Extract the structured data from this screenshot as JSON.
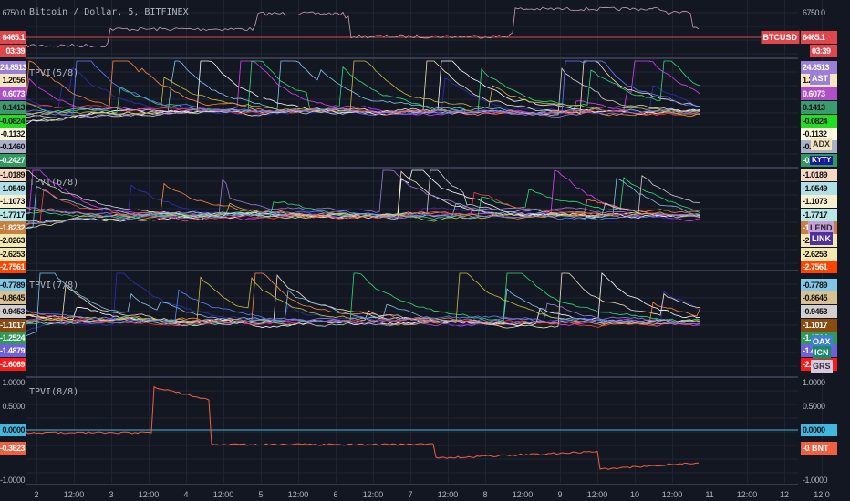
{
  "symbol_title": "Bitcoin / Dollar, 5, BITFINEX",
  "btc": {
    "axis_top": "6750.0",
    "price": "6465.1",
    "countdown": "03:39",
    "tag": "BTCUSD",
    "colors": {
      "price": "#e0474c"
    }
  },
  "panes": [
    {
      "title": "TPVI(5/8)",
      "labels": [
        "24.8513",
        "1.2056",
        "0.6073",
        "0.1413",
        "-0.0824",
        "-0.1132",
        "-0.1460",
        "-0.2427"
      ],
      "tags": [
        "AST",
        "ADX",
        "KYTY"
      ]
    },
    {
      "title": "TPVI(6/8)",
      "labels": [
        "-1.0189",
        "-1.0549",
        "-1.1073",
        "-1.7717",
        "-1.8232",
        "-2.0263",
        "-2.6253",
        "-2.7561"
      ],
      "tags": [
        "LEND",
        "LINK"
      ]
    },
    {
      "title": "TPVI(7/8)",
      "labels": [
        "-0.7789",
        "-0.8645",
        "-0.9453",
        "-1.1017",
        "-1.2524",
        "-1.4879",
        "-2.6069"
      ],
      "tags": [
        "OAX",
        "ICN",
        "GRS"
      ]
    },
    {
      "title": "TPVI(8/8)",
      "labels": [
        "1.0000",
        "0.5000",
        "0.0000",
        "-0.3623",
        "-1.0000"
      ],
      "tags": [
        "BNT"
      ]
    }
  ],
  "x_ticks": [
    "2",
    "12:00",
    "3",
    "12:00",
    "4",
    "12:00",
    "5",
    "12:00",
    "6",
    "12:00",
    "7",
    "12:00",
    "8",
    "12:00",
    "9",
    "12:00",
    "10",
    "12:00",
    "11",
    "12:00",
    "12",
    "12:0"
  ],
  "series_colors": [
    "#e040fb",
    "#3030c0",
    "#ffffff",
    "#f5e6c0",
    "#80c8e8",
    "#ff8a40",
    "#2ee07a",
    "#d0d0d0",
    "#ff4040",
    "#9c7fd6",
    "#c8c040",
    "#6080ff"
  ]
}
